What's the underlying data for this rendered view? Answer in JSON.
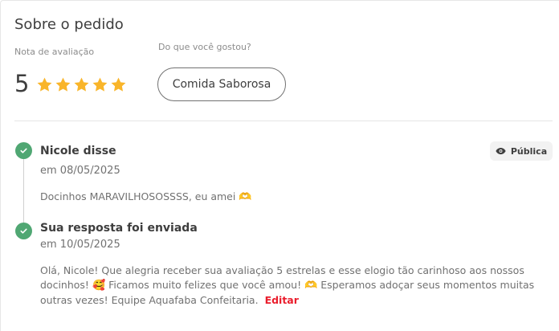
{
  "section": {
    "title": "Sobre o pedido",
    "rating_label": "Nota de avaliação",
    "liked_label": "Do que você gostou?",
    "rating_value": "5",
    "stars": 5,
    "star_color": "#f9b52a",
    "liked_tags": [
      "Comida Saborosa"
    ]
  },
  "timeline": {
    "review": {
      "heading": "Nicole disse",
      "date": "em 08/05/2025",
      "text": "Docinhos MARAVILHOSOSSSS, eu amei",
      "emoji": "🫶",
      "visibility_label": "Pública",
      "visibility_icon": "eye-icon"
    },
    "reply": {
      "heading": "Sua resposta foi enviada",
      "date": "em 10/05/2025",
      "text_part1": "Olá, Nicole! Que alegria receber sua avaliação 5 estrelas e esse elogio tão carinhoso aos nossos docinhos!",
      "emoji1": "🥰",
      "text_part2": "Ficamos muito felizes que você amou!",
      "emoji2": "🫶",
      "text_part3": "Esperamos adoçar seus momentos muitas outras vezes! Equipe Aquafaba Confeitaria.",
      "edit_label": "Editar"
    },
    "check_color": "#50a773",
    "accent_color": "#ea1d2c"
  }
}
